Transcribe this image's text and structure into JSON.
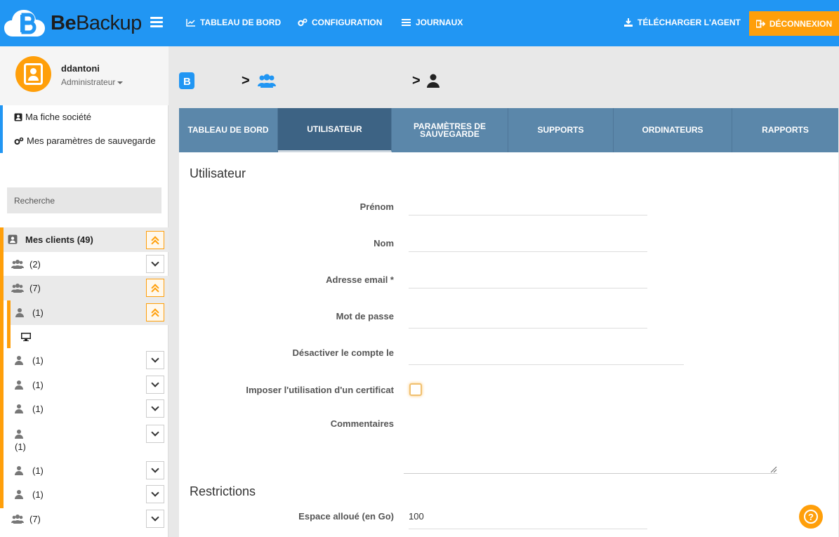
{
  "brand": {
    "prefix": "Be",
    "suffix": "Backup"
  },
  "nav": {
    "dashboard": "TABLEAU DE BORD",
    "configuration": "CONFIGURATION",
    "logs": "JOURNAUX",
    "download_agent": "TÉLÉCHARGER L'AGENT",
    "logout": "DÉCONNEXION"
  },
  "colors": {
    "primary": "#2196f3",
    "accent": "#ff9f0a",
    "tab_bar": "#5b87aa",
    "tab_active": "#3d6384"
  },
  "profile": {
    "username": "ddantoni",
    "role": "Administrateur"
  },
  "sidebar": {
    "links": [
      "Ma fiche société",
      "Mes paramètres de sauvegarde"
    ],
    "search_placeholder": "Recherche",
    "tree": [
      {
        "label": "Mes clients",
        "count": "(49)",
        "icon": "address-book-icon",
        "expanded": true
      },
      {
        "label": "",
        "count": "(2)",
        "icon": "users-icon",
        "expanded": false
      },
      {
        "label": "",
        "count": "(7)",
        "icon": "users-icon",
        "expanded": true
      },
      {
        "label": "",
        "count": "(1)",
        "icon": "user-icon",
        "expanded": true
      },
      {
        "label": "",
        "count": "",
        "icon": "desktop-icon"
      },
      {
        "label": "",
        "count": "(1)",
        "icon": "user-icon",
        "expanded": false
      },
      {
        "label": "",
        "count": "(1)",
        "icon": "user-icon",
        "expanded": false
      },
      {
        "label": "",
        "count": "(1)",
        "icon": "user-icon",
        "expanded": false
      },
      {
        "label": "",
        "count": "(1)",
        "icon": "user-icon",
        "expanded": false
      },
      {
        "label": "",
        "count": "(1)",
        "icon": "user-icon",
        "expanded": false
      },
      {
        "label": "",
        "count": "(1)",
        "icon": "user-icon",
        "expanded": false
      },
      {
        "label": "",
        "count": "(7)",
        "icon": "users-icon",
        "expanded": false
      }
    ]
  },
  "breadcrumb": [
    "",
    "",
    ""
  ],
  "tabs": [
    "TABLEAU DE BORD",
    "UTILISATEUR",
    "PARAMÈTRES DE SAUVEGARDE",
    "SUPPORTS",
    "ORDINATEURS",
    "RAPPORTS"
  ],
  "form": {
    "section_user": "Utilisateur",
    "firstname_label": "Prénom",
    "firstname_value": "",
    "lastname_label": "Nom",
    "lastname_value": "",
    "email_label": "Adresse email *",
    "email_value": "",
    "password_label": "Mot de passe",
    "disable_label": "Désactiver le compte le",
    "certificate_label": "Imposer l'utilisation d'un certificat",
    "comments_label": "Commentaires",
    "section_restrictions": "Restrictions",
    "quota_label": "Espace alloué (en Go)",
    "quota_value": "100"
  },
  "help": "?"
}
